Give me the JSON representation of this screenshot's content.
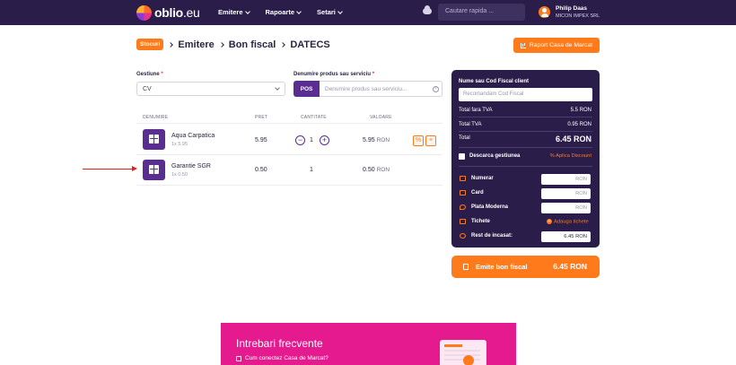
{
  "nav": {
    "logo_main": "oblio",
    "logo_suffix": ".eu",
    "menu": [
      "Emitere",
      "Rapoarte",
      "Setari"
    ],
    "search_placeholder": "Cautare rapida ...",
    "user_name": "Philip Daas",
    "user_company": "MICON IMPEX SRL",
    "icons": [
      "cloud-icon",
      "avatar-icon"
    ]
  },
  "breadcrumb": {
    "badge": "Stocuri",
    "items": [
      "Emitere",
      "Bon fiscal",
      "DATECS"
    ]
  },
  "report_button": "Raport Casa de Marcat",
  "form": {
    "gestiune_label": "Gestiune",
    "gestiune_value": "CV",
    "produs_label": "Denumire produs sau serviciu",
    "pos_label": "POS",
    "produs_placeholder": "Denumire produs sau serviciu...",
    "required_mark": "*"
  },
  "table": {
    "headers": [
      "DENUMIRE",
      "PRET",
      "CANTITATE",
      "VALOARE"
    ],
    "rows": [
      {
        "name": "Aqua Carpatica",
        "sub": "1x 5.95",
        "price": "5.95",
        "qty": "1",
        "value": "5.95",
        "currency": "RON"
      },
      {
        "name": "Garantie SGR",
        "sub": "1x 0.50",
        "price": "0.50",
        "qty": "1",
        "value": "0.50",
        "currency": "RON"
      }
    ],
    "minus": "−",
    "plus": "+",
    "discount_icon": "%",
    "remove_icon": "×"
  },
  "summary": {
    "cf_label": "Nume sau Cod Fiscal client",
    "cf_placeholder": "Recomandam Cod Fiscal",
    "total_fara_tva_label": "Total fara TVA",
    "total_fara_tva_value": "5.5 RON",
    "total_tva_label": "Total TVA",
    "total_tva_value": "0.95 RON",
    "total_label": "Total",
    "total_value": "6.45 RON",
    "descarca_label": "Descarca gestiunea",
    "discount_label": "% Aplica Discount",
    "payments": [
      {
        "label": "Numerar",
        "value": "RON"
      },
      {
        "label": "Card",
        "value": "RON"
      },
      {
        "label": "Plata Moderna",
        "value": "RON"
      }
    ],
    "tichete_label": "Tichete",
    "tichete_action": "Adauga tichete",
    "rest_label": "Rest de incasat:",
    "rest_value": "6.45 RON"
  },
  "emit": {
    "label": "Emite bon fiscal",
    "total": "6.45 RON"
  },
  "faq": {
    "title": "Intrebari frecvente",
    "item": "Cum conectez Casa de Marcat?"
  },
  "colors": {
    "primary_dark": "#2a1d4a",
    "purple": "#5a2d91",
    "orange": "#ff7a1a",
    "pink": "#e51a8f",
    "annotation_arrow": "#e02020"
  }
}
